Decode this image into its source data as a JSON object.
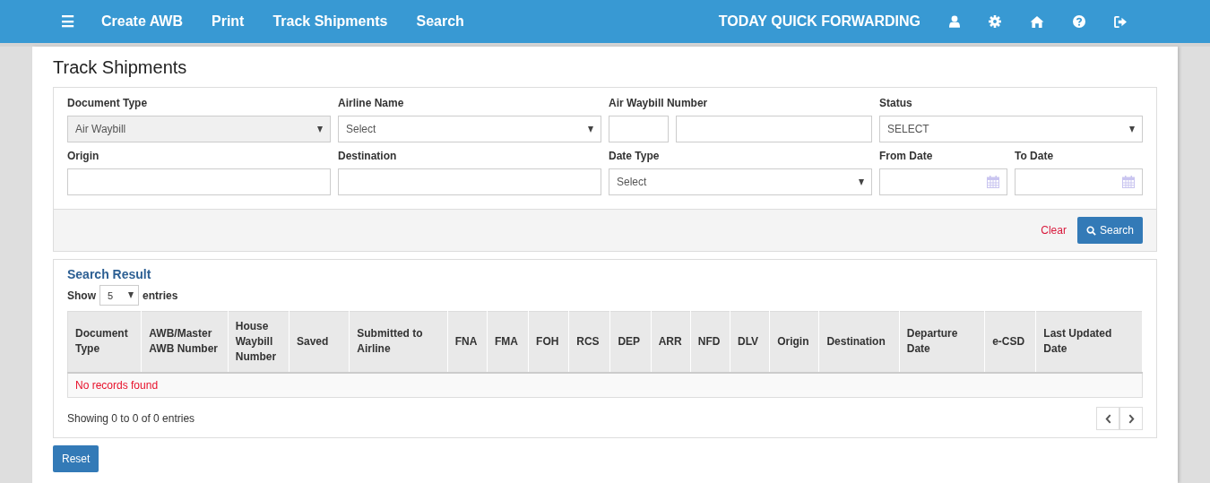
{
  "navbar": {
    "menu_icon": "☰",
    "links": [
      "Create AWB",
      "Print",
      "Track Shipments",
      "Search"
    ],
    "company": "TODAY QUICK FORWARDING"
  },
  "page_title": "Track Shipments",
  "filters": [
    {
      "kind": "select",
      "label": "Document Type",
      "value": "Air Waybill",
      "disabled": true
    },
    {
      "kind": "select",
      "label": "Airline Name",
      "value": "Select",
      "disabled": false
    },
    {
      "kind": "split",
      "label": "Air Waybill Number"
    },
    {
      "kind": "select",
      "label": "Status",
      "value": "SELECT",
      "disabled": false
    },
    {
      "kind": "input",
      "label": "Origin"
    },
    {
      "kind": "input",
      "label": "Destination"
    },
    {
      "kind": "select",
      "label": "Date Type",
      "value": "Select",
      "disabled": false
    },
    {
      "kind": "date",
      "label": "From Date"
    },
    {
      "kind": "date",
      "label": "To Date"
    }
  ],
  "actions": {
    "clear": "Clear",
    "search": "Search"
  },
  "results": {
    "title": "Search Result",
    "show_label": "Show",
    "page_size": "5",
    "entries_label": "entries",
    "columns": [
      "Document Type",
      "AWB/Master AWB Number",
      "House Waybill Number",
      "Saved",
      "Submitted to Airline",
      "FNA",
      "FMA",
      "FOH",
      "RCS",
      "DEP",
      "ARR",
      "NFD",
      "DLV",
      "Origin",
      "Destination",
      "Departure Date",
      "e-CSD",
      "Last Updated Date"
    ],
    "empty_message": "No records found",
    "info": "Showing 0 to 0 of 0 entries"
  },
  "reset_button": "Reset"
}
